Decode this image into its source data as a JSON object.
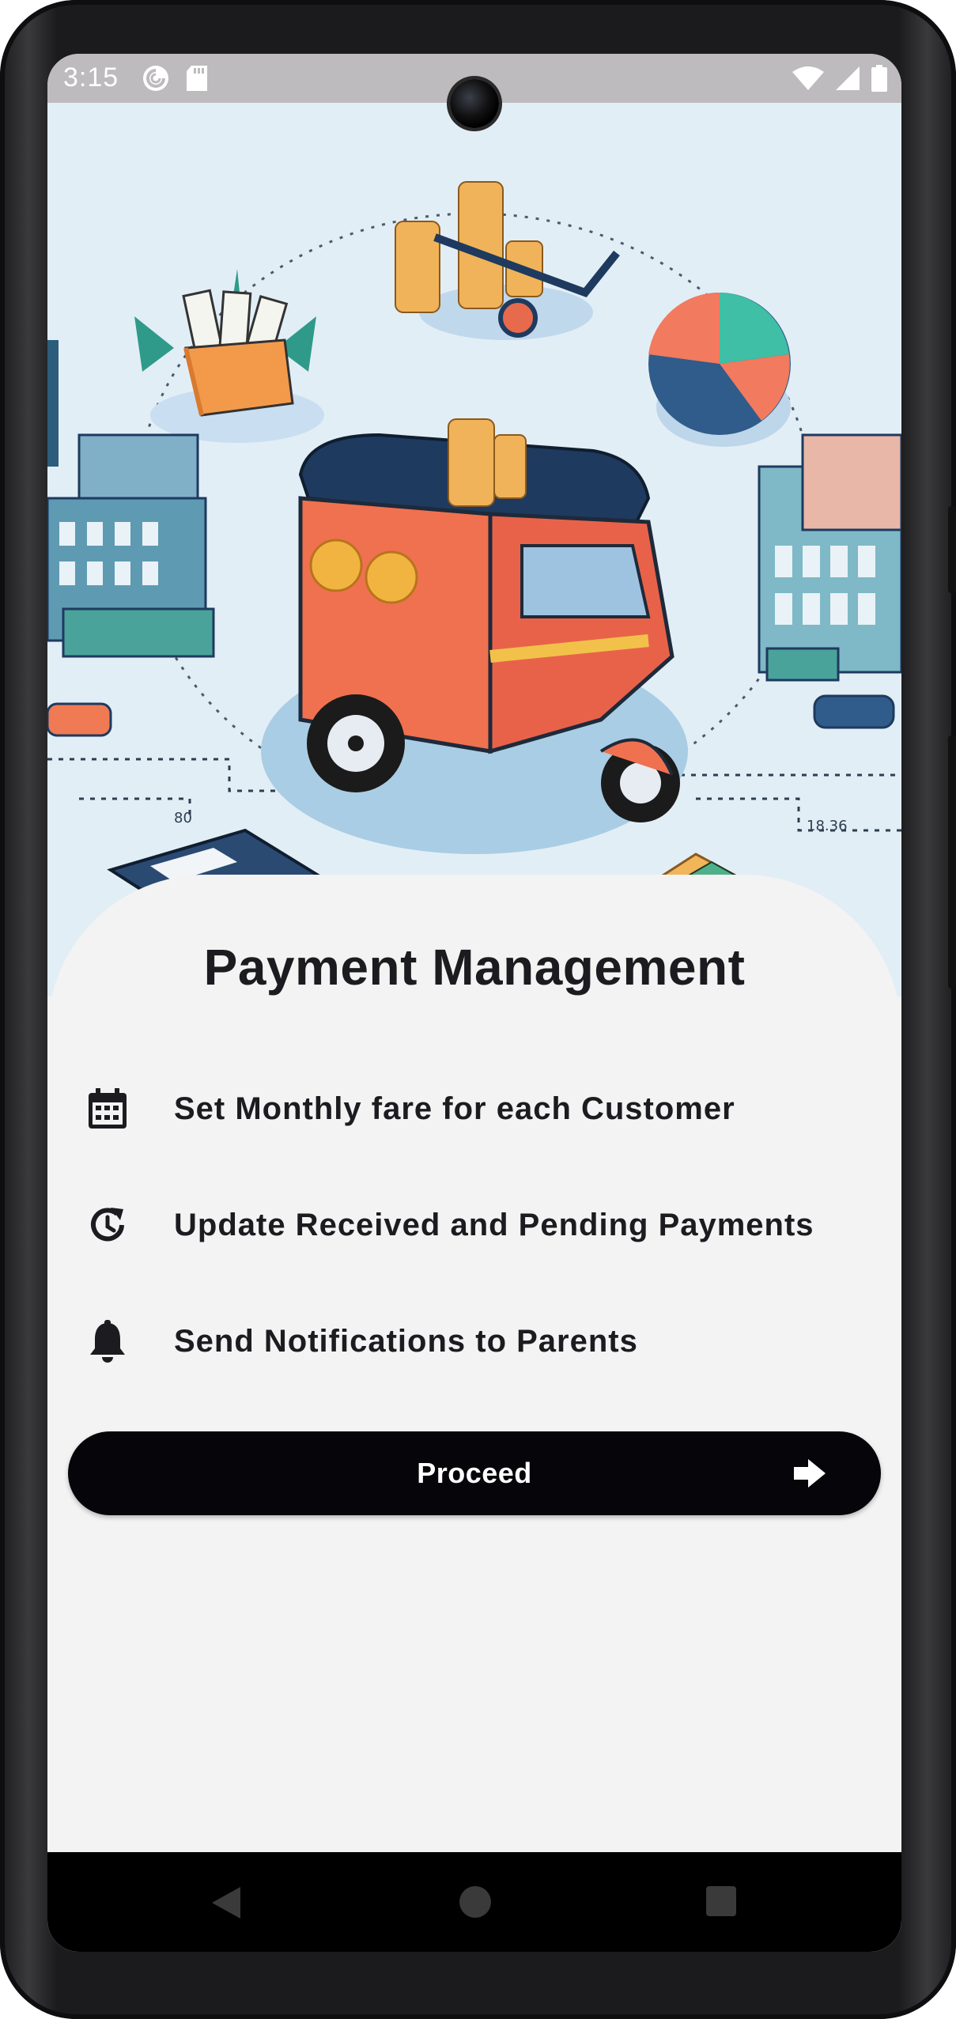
{
  "status_bar": {
    "time": "3:15",
    "left_icons": [
      "pocket-casts-icon",
      "sd-card-icon"
    ],
    "right_icons": [
      "wifi-icon",
      "cellular-signal-icon",
      "battery-icon"
    ]
  },
  "hero": {
    "description_icon": "auto-rickshaw-finance-illustration"
  },
  "page": {
    "title": "Payment Management",
    "features": [
      {
        "icon": "calendar-icon",
        "label": "Set Monthly fare for each Customer"
      },
      {
        "icon": "history-icon",
        "label": "Update Received and Pending Payments"
      },
      {
        "icon": "bell-icon",
        "label": "Send Notifications to Parents"
      }
    ],
    "proceed_label": "Proceed",
    "proceed_icon": "arrow-right-icon"
  },
  "nav_bar": {
    "buttons": [
      "back-icon",
      "home-icon",
      "recents-icon"
    ]
  },
  "colors": {
    "background": "#f3f3f4",
    "button": "#06060a",
    "text": "#1c1b1f",
    "hero_bg": "#e2eef6",
    "accent_coral": "#f06a4f",
    "accent_navy": "#1e3a5f",
    "accent_teal": "#34b8a0"
  }
}
